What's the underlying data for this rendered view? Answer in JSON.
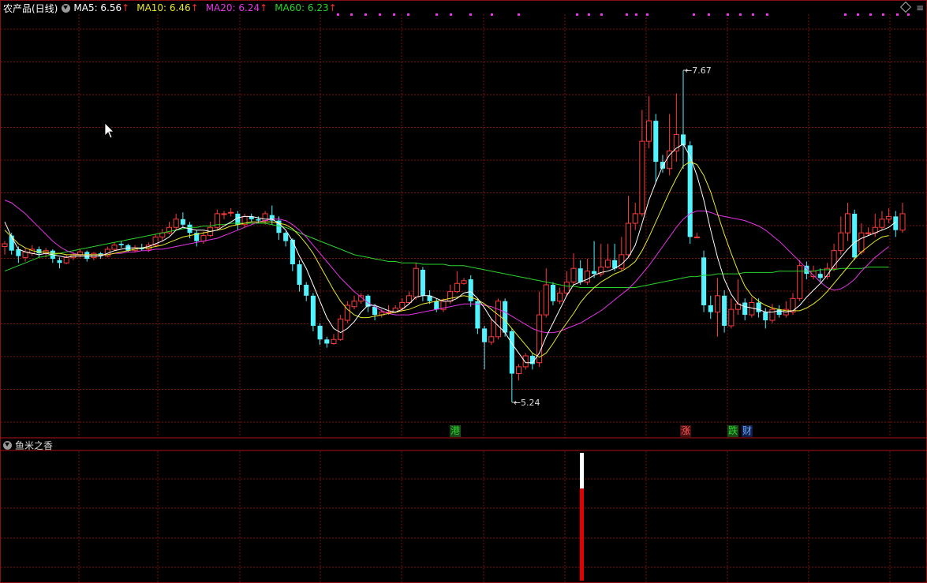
{
  "header": {
    "title": "农产品(日线)",
    "ma5": "MA5: 6.56",
    "ma10": "MA10: 6.46",
    "ma20": "MA20: 6.24",
    "ma60": "MA60: 6.23",
    "arrow": "↑"
  },
  "sub_panel": {
    "title": "鱼米之香"
  },
  "tags": {
    "gang": "港",
    "zhang": "涨",
    "die": "跌",
    "cai": "财"
  },
  "annotations": {
    "high": "7.67",
    "low": "5.24",
    "arrow_glyph": "←"
  },
  "colors": {
    "up": "#ff3b3b",
    "down": "#52f2ff",
    "ma5": "#ffffff",
    "ma10": "#e8e82a",
    "ma20": "#e633e6",
    "ma60": "#2ad32a",
    "grid": "#7a0f0f",
    "bg": "#000000"
  },
  "chart_data": {
    "type": "candlestick",
    "y_range": [
      4.98,
      8.08
    ],
    "high_marker": 7.67,
    "low_marker": 5.24,
    "candles": [
      [
        6.38,
        6.4,
        6.32,
        6.42
      ],
      [
        6.46,
        6.35,
        6.32,
        6.48
      ],
      [
        6.36,
        6.31,
        6.26,
        6.38
      ],
      [
        6.3,
        6.34,
        6.27,
        6.37
      ],
      [
        6.33,
        6.36,
        6.31,
        6.39
      ],
      [
        6.36,
        6.33,
        6.3,
        6.38
      ],
      [
        6.33,
        6.35,
        6.3,
        6.37
      ],
      [
        6.35,
        6.29,
        6.26,
        6.36
      ],
      [
        6.28,
        6.26,
        6.22,
        6.3
      ],
      [
        6.26,
        6.3,
        6.25,
        6.32
      ],
      [
        6.3,
        6.32,
        6.28,
        6.34
      ],
      [
        6.32,
        6.34,
        6.3,
        6.36
      ],
      [
        6.34,
        6.29,
        6.27,
        6.35
      ],
      [
        6.3,
        6.33,
        6.28,
        6.34
      ],
      [
        6.33,
        6.31,
        6.29,
        6.34
      ],
      [
        6.31,
        6.36,
        6.3,
        6.38
      ],
      [
        6.36,
        6.39,
        6.35,
        6.41
      ],
      [
        6.4,
        6.39,
        6.37,
        6.42
      ],
      [
        6.39,
        6.35,
        6.34,
        6.4
      ],
      [
        6.35,
        6.37,
        6.34,
        6.39
      ],
      [
        6.37,
        6.36,
        6.35,
        6.4
      ],
      [
        6.36,
        6.39,
        6.34,
        6.41
      ],
      [
        6.39,
        6.45,
        6.38,
        6.47
      ],
      [
        6.45,
        6.48,
        6.42,
        6.51
      ],
      [
        6.48,
        6.52,
        6.47,
        6.56
      ],
      [
        6.52,
        6.58,
        6.5,
        6.62
      ],
      [
        6.58,
        6.54,
        6.52,
        6.63
      ],
      [
        6.54,
        6.48,
        6.44,
        6.56
      ],
      [
        6.48,
        6.42,
        6.38,
        6.5
      ],
      [
        6.42,
        6.46,
        6.4,
        6.49
      ],
      [
        6.46,
        6.52,
        6.45,
        6.56
      ],
      [
        6.52,
        6.62,
        6.5,
        6.65
      ],
      [
        6.62,
        6.62,
        6.58,
        6.64
      ],
      [
        6.63,
        6.63,
        6.6,
        6.66
      ],
      [
        6.62,
        6.54,
        6.5,
        6.64
      ],
      [
        6.54,
        6.6,
        6.52,
        6.62
      ],
      [
        6.6,
        6.58,
        6.56,
        6.62
      ],
      [
        6.58,
        6.57,
        6.55,
        6.6
      ],
      [
        6.57,
        6.62,
        6.54,
        6.64
      ],
      [
        6.61,
        6.57,
        6.54,
        6.68
      ],
      [
        6.57,
        6.48,
        6.43,
        6.6
      ],
      [
        6.48,
        6.42,
        6.38,
        6.49
      ],
      [
        6.43,
        6.25,
        6.2,
        6.44
      ],
      [
        6.25,
        6.1,
        6.05,
        6.28
      ],
      [
        6.1,
        6.02,
        5.98,
        6.12
      ],
      [
        6.02,
        5.8,
        5.76,
        6.04
      ],
      [
        5.8,
        5.7,
        5.66,
        5.82
      ],
      [
        5.7,
        5.67,
        5.64,
        5.72
      ],
      [
        5.67,
        5.7,
        5.66,
        5.74
      ],
      [
        5.7,
        5.85,
        5.69,
        5.88
      ],
      [
        5.84,
        5.95,
        5.82,
        5.98
      ],
      [
        5.94,
        5.98,
        5.92,
        6.02
      ],
      [
        5.98,
        6.02,
        5.96,
        6.04
      ],
      [
        6.02,
        5.94,
        5.9,
        6.03
      ],
      [
        5.94,
        5.88,
        5.84,
        5.96
      ],
      [
        5.88,
        5.9,
        5.86,
        5.92
      ],
      [
        5.9,
        5.9,
        5.88,
        5.95
      ],
      [
        5.9,
        5.93,
        5.89,
        5.95
      ],
      [
        5.93,
        5.97,
        5.91,
        6.0
      ],
      [
        5.97,
        6.02,
        5.96,
        6.05
      ],
      [
        6.01,
        6.22,
        5.99,
        6.26
      ],
      [
        6.21,
        6.02,
        5.98,
        6.23
      ],
      [
        6.02,
        5.98,
        5.96,
        6.06
      ],
      [
        5.98,
        5.92,
        5.9,
        6.0
      ],
      [
        5.92,
        5.98,
        5.9,
        6.0
      ],
      [
        5.98,
        6.05,
        5.96,
        6.1
      ],
      [
        6.05,
        6.11,
        6.04,
        6.2
      ],
      [
        6.11,
        6.13,
        6.1,
        6.15
      ],
      [
        6.14,
        5.98,
        5.94,
        6.17
      ],
      [
        5.98,
        5.78,
        5.74,
        6.0
      ],
      [
        5.78,
        5.68,
        5.48,
        5.8
      ],
      [
        5.68,
        5.72,
        5.66,
        5.85
      ],
      [
        5.72,
        5.98,
        5.7,
        6.0
      ],
      [
        5.98,
        5.75,
        5.72,
        6.0
      ],
      [
        5.76,
        5.45,
        5.24,
        5.78
      ],
      [
        5.45,
        5.5,
        5.4,
        5.52
      ],
      [
        5.5,
        5.58,
        5.48,
        5.6
      ],
      [
        5.58,
        5.52,
        5.48,
        5.6
      ],
      [
        5.53,
        5.88,
        5.5,
        6.05
      ],
      [
        5.88,
        6.1,
        5.86,
        6.22
      ],
      [
        6.1,
        5.98,
        5.95,
        6.12
      ],
      [
        5.98,
        6.04,
        5.96,
        6.08
      ],
      [
        6.04,
        6.12,
        6.02,
        6.2
      ],
      [
        6.12,
        6.22,
        6.1,
        6.33
      ],
      [
        6.22,
        6.12,
        6.1,
        6.28
      ],
      [
        6.12,
        6.2,
        6.1,
        6.29
      ],
      [
        6.2,
        6.18,
        6.15,
        6.42
      ],
      [
        6.18,
        6.23,
        6.16,
        6.4
      ],
      [
        6.23,
        6.28,
        6.22,
        6.4
      ],
      [
        6.28,
        6.22,
        6.2,
        6.4
      ],
      [
        6.22,
        6.32,
        6.2,
        6.45
      ],
      [
        6.32,
        6.55,
        6.3,
        6.75
      ],
      [
        6.55,
        6.62,
        6.5,
        6.7
      ],
      [
        6.62,
        7.15,
        6.6,
        7.38
      ],
      [
        7.15,
        7.3,
        7.1,
        7.48
      ],
      [
        7.3,
        7.0,
        6.85,
        7.35
      ],
      [
        7.0,
        6.95,
        6.92,
        7.05
      ],
      [
        6.95,
        7.08,
        6.9,
        7.35
      ],
      [
        7.08,
        7.2,
        7.0,
        7.5
      ],
      [
        7.2,
        7.12,
        6.95,
        7.67
      ],
      [
        7.12,
        6.45,
        6.4,
        7.15
      ],
      [
        6.45,
        6.45,
        6.44,
        6.48
      ],
      [
        6.3,
        5.95,
        5.9,
        6.35
      ],
      [
        5.95,
        5.9,
        5.85,
        6.02
      ],
      [
        5.9,
        6.02,
        5.72,
        6.15
      ],
      [
        6.02,
        5.8,
        5.75,
        6.06
      ],
      [
        5.8,
        5.92,
        5.78,
        6.0
      ],
      [
        5.92,
        5.96,
        5.88,
        6.14
      ],
      [
        5.97,
        5.88,
        5.84,
        6.0
      ],
      [
        5.88,
        5.97,
        5.86,
        6.01
      ],
      [
        5.97,
        5.9,
        5.86,
        6.0
      ],
      [
        5.9,
        5.84,
        5.78,
        5.93
      ],
      [
        5.84,
        5.92,
        5.82,
        5.96
      ],
      [
        5.92,
        5.88,
        5.86,
        5.95
      ],
      [
        5.88,
        5.92,
        5.86,
        5.98
      ],
      [
        5.9,
        6.0,
        5.88,
        6.04
      ],
      [
        6.0,
        6.24,
        5.98,
        6.28
      ],
      [
        6.24,
        6.18,
        6.14,
        6.27
      ],
      [
        6.16,
        6.2,
        6.14,
        6.24
      ],
      [
        6.18,
        6.15,
        6.12,
        6.22
      ],
      [
        6.16,
        6.22,
        6.14,
        6.26
      ],
      [
        6.22,
        6.35,
        6.2,
        6.4
      ],
      [
        6.35,
        6.48,
        6.32,
        6.6
      ],
      [
        6.48,
        6.62,
        6.42,
        6.7
      ],
      [
        6.62,
        6.3,
        6.28,
        6.65
      ],
      [
        6.34,
        6.48,
        6.32,
        6.55
      ],
      [
        6.48,
        6.48,
        6.46,
        6.52
      ],
      [
        6.48,
        6.52,
        6.45,
        6.62
      ],
      [
        6.52,
        6.58,
        6.5,
        6.64
      ],
      [
        6.58,
        6.6,
        6.55,
        6.66
      ],
      [
        6.6,
        6.5,
        6.45,
        6.64
      ],
      [
        6.5,
        6.62,
        6.48,
        6.7
      ]
    ],
    "ma5": [
      6.56,
      6.45,
      6.36,
      6.34,
      6.33,
      6.32,
      6.33,
      6.32,
      6.31,
      6.3,
      6.31,
      6.31,
      6.31,
      6.31,
      6.31,
      6.33,
      6.35,
      6.36,
      6.37,
      6.37,
      6.37,
      6.38,
      6.4,
      6.42,
      6.45,
      6.5,
      6.52,
      6.51,
      6.5,
      6.5,
      6.49,
      6.5,
      6.53,
      6.56,
      6.59,
      6.6,
      6.6,
      6.59,
      6.58,
      6.58,
      6.55,
      6.5,
      6.42,
      6.31,
      6.22,
      6.1,
      5.98,
      5.86,
      5.78,
      5.75,
      5.78,
      5.83,
      5.9,
      5.95,
      5.95,
      5.93,
      5.91,
      5.9,
      5.92,
      5.96,
      6.01,
      6.02,
      6.02,
      6.0,
      5.98,
      5.98,
      6.0,
      6.04,
      6.05,
      6.0,
      5.93,
      5.85,
      5.8,
      5.75,
      5.67,
      5.6,
      5.53,
      5.53,
      5.6,
      5.72,
      5.82,
      5.92,
      6.02,
      6.1,
      6.12,
      6.14,
      6.17,
      6.19,
      6.2,
      6.22,
      6.25,
      6.3,
      6.39,
      6.55,
      6.72,
      6.85,
      6.97,
      7.05,
      7.1,
      7.13,
      7.04,
      6.9,
      6.72,
      6.5,
      6.3,
      6.14,
      6.03,
      5.96,
      5.94,
      5.93,
      5.92,
      5.9,
      5.9,
      5.91,
      5.9,
      5.91,
      5.95,
      6.01,
      6.06,
      6.11,
      6.17,
      6.24,
      6.3,
      6.36,
      6.41,
      6.44,
      6.46,
      6.48,
      6.5,
      6.52,
      6.56
    ],
    "ma10": [
      6.5,
      6.45,
      6.4,
      6.37,
      6.35,
      6.34,
      6.34,
      6.33,
      6.33,
      6.32,
      6.32,
      6.32,
      6.32,
      6.32,
      6.32,
      6.32,
      6.33,
      6.34,
      6.35,
      6.36,
      6.37,
      6.37,
      6.38,
      6.39,
      6.41,
      6.43,
      6.45,
      6.46,
      6.47,
      6.48,
      6.49,
      6.5,
      6.51,
      6.53,
      6.54,
      6.55,
      6.56,
      6.56,
      6.56,
      6.56,
      6.55,
      6.54,
      6.51,
      6.46,
      6.4,
      6.33,
      6.24,
      6.15,
      6.06,
      5.98,
      5.92,
      5.88,
      5.86,
      5.86,
      5.87,
      5.88,
      5.89,
      5.9,
      5.91,
      5.92,
      5.94,
      5.96,
      5.97,
      5.98,
      5.99,
      6.0,
      6.01,
      6.02,
      6.01,
      5.99,
      5.96,
      5.92,
      5.88,
      5.84,
      5.78,
      5.72,
      5.66,
      5.6,
      5.57,
      5.6,
      5.67,
      5.75,
      5.82,
      5.89,
      5.97,
      6.03,
      6.08,
      6.12,
      6.15,
      6.18,
      6.2,
      6.23,
      6.27,
      6.35,
      6.45,
      6.56,
      6.67,
      6.78,
      6.88,
      6.97,
      7.0,
      6.98,
      6.9,
      6.78,
      6.62,
      6.47,
      6.33,
      6.2,
      6.09,
      6.02,
      5.98,
      5.95,
      5.93,
      5.92,
      5.91,
      5.91,
      5.91,
      5.93,
      5.96,
      6.0,
      6.05,
      6.11,
      6.17,
      6.23,
      6.29,
      6.34,
      6.38,
      6.42,
      6.45,
      6.46
    ],
    "ma20": [
      6.72,
      6.7,
      6.66,
      6.62,
      6.57,
      6.52,
      6.47,
      6.42,
      6.38,
      6.35,
      6.33,
      6.32,
      6.32,
      6.32,
      6.32,
      6.32,
      6.33,
      6.33,
      6.34,
      6.34,
      6.35,
      6.35,
      6.36,
      6.36,
      6.37,
      6.38,
      6.39,
      6.4,
      6.41,
      6.42,
      6.43,
      6.44,
      6.46,
      6.48,
      6.5,
      6.52,
      6.54,
      6.56,
      6.57,
      6.58,
      6.58,
      6.57,
      6.54,
      6.5,
      6.45,
      6.39,
      6.33,
      6.27,
      6.21,
      6.15,
      6.1,
      6.05,
      6.01,
      5.97,
      5.94,
      5.91,
      5.89,
      5.88,
      5.88,
      5.88,
      5.89,
      5.9,
      5.91,
      5.92,
      5.93,
      5.94,
      5.95,
      5.96,
      5.96,
      5.96,
      5.95,
      5.94,
      5.92,
      5.9,
      5.87,
      5.84,
      5.81,
      5.78,
      5.76,
      5.75,
      5.75,
      5.76,
      5.78,
      5.8,
      5.82,
      5.85,
      5.88,
      5.91,
      5.95,
      5.99,
      6.03,
      6.07,
      6.12,
      6.18,
      6.24,
      6.31,
      6.38,
      6.45,
      6.52,
      6.58,
      6.62,
      6.64,
      6.64,
      6.63,
      6.61,
      6.6,
      6.59,
      6.58,
      6.57,
      6.55,
      6.53,
      6.5,
      6.46,
      6.42,
      6.37,
      6.32,
      6.27,
      6.22,
      6.17,
      6.12,
      6.08,
      6.06,
      6.07,
      6.1,
      6.14,
      6.2,
      6.25,
      6.3,
      6.34,
      6.38
    ],
    "ma60": [
      6.2,
      6.22,
      6.24,
      6.26,
      6.28,
      6.3,
      6.31,
      6.32,
      6.33,
      6.34,
      6.35,
      6.36,
      6.37,
      6.38,
      6.39,
      6.4,
      6.41,
      6.42,
      6.43,
      6.44,
      6.45,
      6.46,
      6.47,
      6.48,
      6.49,
      6.5,
      6.51,
      6.52,
      6.52,
      6.53,
      6.53,
      6.54,
      6.54,
      6.55,
      6.55,
      6.55,
      6.55,
      6.55,
      6.55,
      6.54,
      6.53,
      6.52,
      6.5,
      6.48,
      6.46,
      6.44,
      6.42,
      6.4,
      6.38,
      6.36,
      6.34,
      6.32,
      6.31,
      6.3,
      6.29,
      6.28,
      6.27,
      6.27,
      6.26,
      6.26,
      6.26,
      6.25,
      6.25,
      6.25,
      6.25,
      6.24,
      6.24,
      6.24,
      6.23,
      6.22,
      6.21,
      6.2,
      6.19,
      6.18,
      6.17,
      6.16,
      6.15,
      6.14,
      6.13,
      6.12,
      6.11,
      6.1,
      6.09,
      6.09,
      6.08,
      6.08,
      6.08,
      6.08,
      6.08,
      6.08,
      6.08,
      6.08,
      6.08,
      6.09,
      6.1,
      6.11,
      6.12,
      6.13,
      6.14,
      6.15,
      6.16,
      6.16,
      6.17,
      6.17,
      6.18,
      6.18,
      6.18,
      6.18,
      6.19,
      6.19,
      6.19,
      6.19,
      6.19,
      6.2,
      6.2,
      6.2,
      6.2,
      6.2,
      6.2,
      6.21,
      6.21,
      6.21,
      6.22,
      6.22,
      6.22,
      6.22,
      6.23,
      6.23,
      6.23,
      6.23
    ],
    "indicator": {
      "white": 0.28,
      "red": 0.72
    }
  }
}
